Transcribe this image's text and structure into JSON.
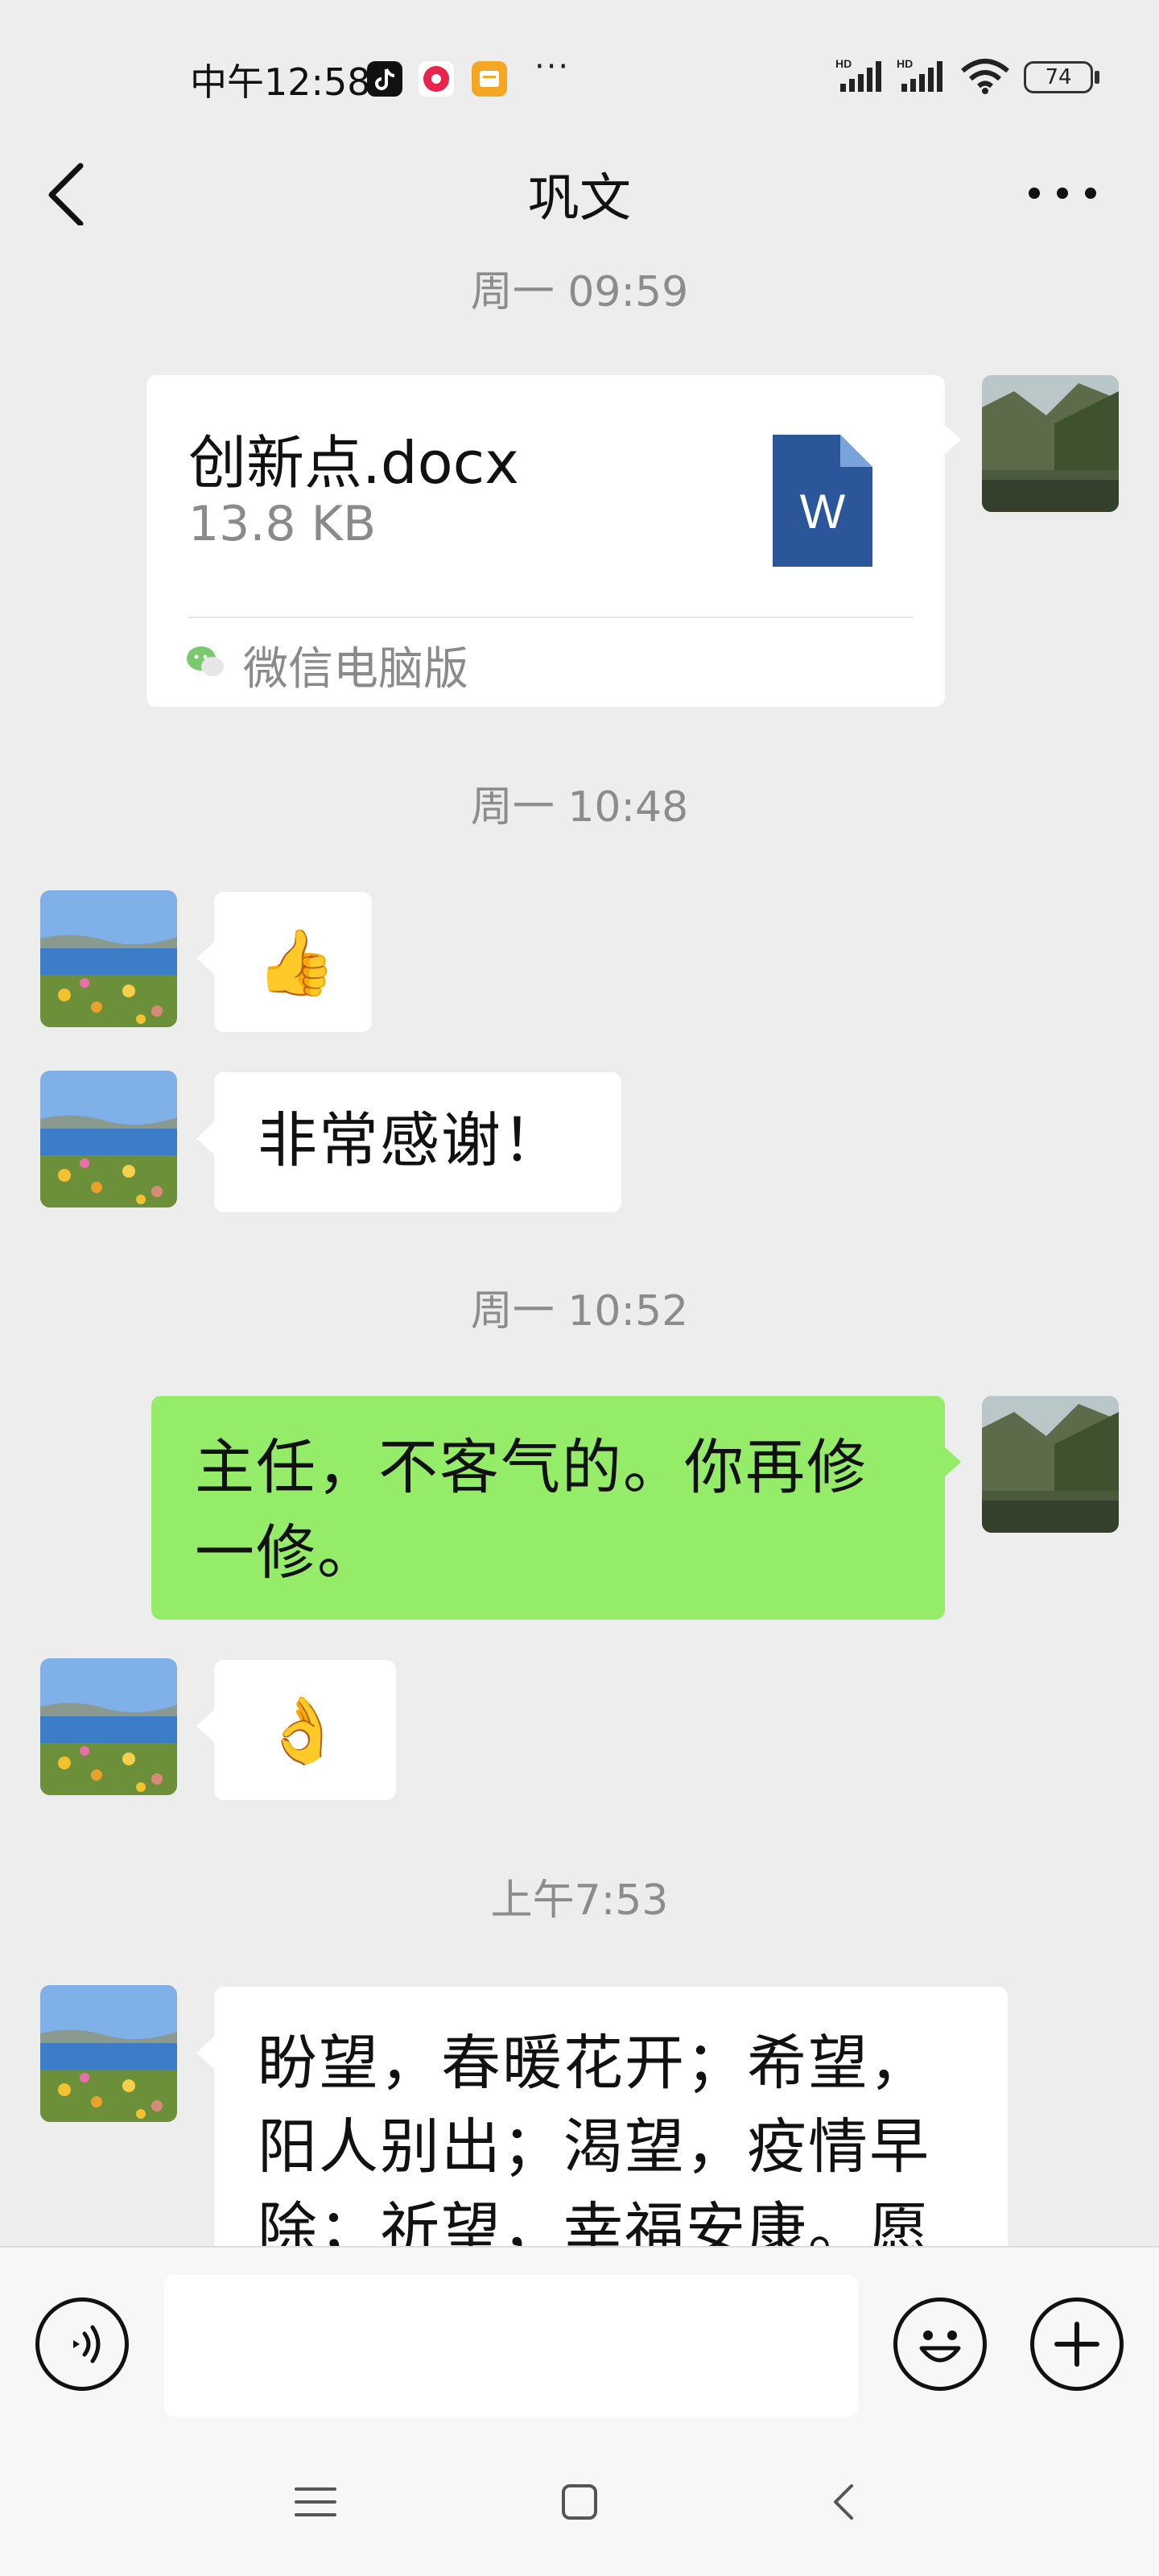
{
  "status_bar": {
    "time": "中午12:58",
    "dots": "···",
    "battery": "74",
    "signal_labels": [
      "HD",
      "HD"
    ]
  },
  "header": {
    "title": "巩文"
  },
  "messages": {
    "ts1": "周一 09:59",
    "file": {
      "name": "创新点.docx",
      "size": "13.8 KB",
      "source": "微信电脑版",
      "icon_letter": "W"
    },
    "ts2": "周一 10:48",
    "thumbs_emoji": "👍",
    "thanks": "非常感谢！",
    "ts3": "周一 10:52",
    "reply": "主任，不客气的。你再修一修。",
    "ok_emoji": "👌",
    "ts4": "上午7:53",
    "long_msg_lines": [
      "盼望，春暖花开；希望，",
      "阳人别出；渴望，疫情早",
      "除；祈望，幸福安康。愿"
    ]
  },
  "input": {
    "placeholder": ""
  },
  "colors": {
    "background": "#ededed",
    "bubble_green": "#95ec69",
    "bubble_white": "#ffffff",
    "timestamp": "#8c8c8c",
    "word_blue": "#2b579a"
  }
}
